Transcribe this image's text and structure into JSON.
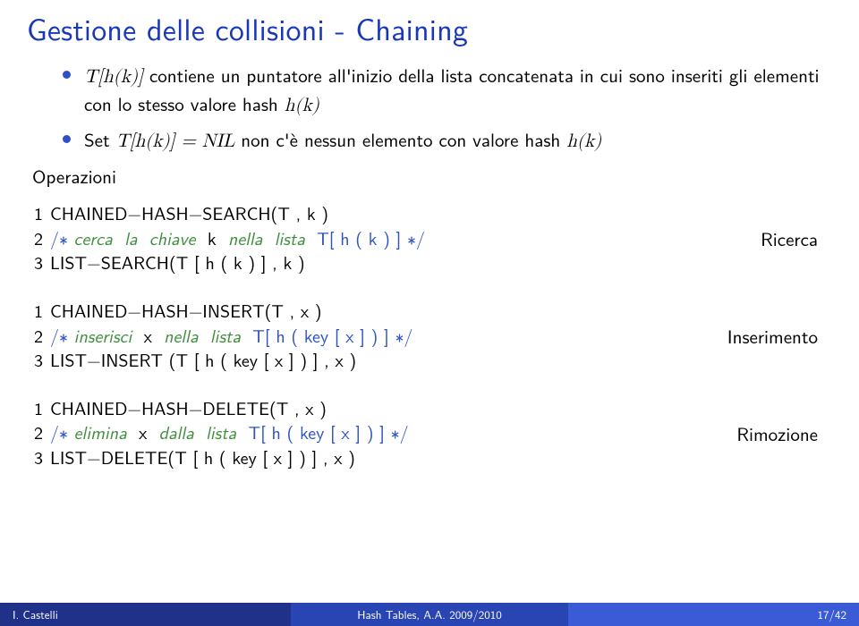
{
  "title": "Gestione delle collisioni - Chaining",
  "bullets": {
    "b1_prefix_math": "T[h(k)]",
    "b1_text": " contiene un puntatore all'inizio della lista concatenata in cui sono inseriti gli elementi con lo stesso valore hash ",
    "b1_suffix_math": "h(k)",
    "b2_prefix": "Set ",
    "b2_math_left": "T[h(k)] = NIL",
    "b2_text": " non c'è nessun elemento con valore hash ",
    "b2_suffix_math": "h(k)"
  },
  "operazioni_label": "Operazioni",
  "code1": {
    "l1": "CHAINED−HASH−SEARCH(T , k )",
    "l2a": "/∗",
    "l2b": "cerca",
    "l2c": "la",
    "l2d": "chiave",
    "l2e": "k",
    "l2f": "nella",
    "l2g": "lista",
    "l2h": "T[ h ( k ) ]",
    "l2i": "∗/",
    "l3": "LIST−SEARCH(T [ h ( k ) ] , k )",
    "label": "Ricerca"
  },
  "code2": {
    "l1": "CHAINED−HASH−INSERT(T , x )",
    "l2a": "/∗",
    "l2b": "inserisci",
    "l2c": "x",
    "l2d": "nella",
    "l2e": "lista",
    "l2f": "T[ h ( key [ x ] ) ]",
    "l2g": "∗/",
    "l3": "LIST−INSERT (T [ h ( key [ x ] ) ] , x )",
    "label": "Inserimento"
  },
  "code3": {
    "l1": "CHAINED−HASH−DELETE(T , x )",
    "l2a": "/∗",
    "l2b": "elimina",
    "l2c": "x",
    "l2d": "dalla",
    "l2e": "lista",
    "l2f": "T[ h ( key [ x ] ) ]",
    "l2g": "∗/",
    "l3": "LIST−DELETE(T [ h ( key [ x ] ) ] , x )",
    "label": "Rimozione"
  },
  "footer": {
    "left": "I. Castelli",
    "center": "Hash Tables, A.A. 2009/2010",
    "right": "17/42"
  }
}
